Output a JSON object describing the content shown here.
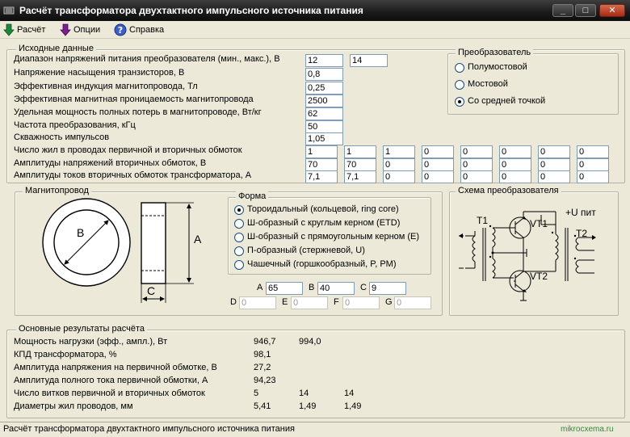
{
  "window": {
    "title": "Расчёт трансформатора двухтактного импульсного источника питания",
    "btn_min": "_",
    "btn_max": "□",
    "btn_close": "✕"
  },
  "toolbar": {
    "calc": "Расчёт",
    "options": "Опции",
    "help": "Справка"
  },
  "input": {
    "title": "Исходные данные",
    "rows": [
      {
        "label": "Диапазон напряжений питания преобразователя (мин., макс.), В",
        "v1": "12",
        "v2": "14"
      },
      {
        "label": "Напряжение насыщения транзисторов, В",
        "v1": "0,8"
      },
      {
        "label": "Эффективная индукция магнитопровода, Тл",
        "v1": "0,25"
      },
      {
        "label": "Эффективная магнитная проницаемость магнитопровода",
        "v1": "2500"
      },
      {
        "label": "Удельная мощность полных потерь в магнитопроводе, Вт/кг",
        "v1": "62"
      },
      {
        "label": "Частота преобразования, кГц",
        "v1": "50"
      },
      {
        "label": "Скважность импульсов",
        "v1": "1,05"
      }
    ],
    "strands_label": "Число жил в проводах первичной и вторичных обмоток",
    "strands": [
      "1",
      "1",
      "1",
      "0",
      "0",
      "0",
      "0",
      "0"
    ],
    "volt_label": "Амплитуды напряжений вторичных обмоток, В",
    "volts": [
      "70",
      "70",
      "0",
      "0",
      "0",
      "0",
      "0",
      "0"
    ],
    "curr_label": "Амплитуды токов вторичных обмоток трансформатора, А",
    "currs": [
      "7,1",
      "7,1",
      "0",
      "0",
      "0",
      "0",
      "0",
      "0"
    ]
  },
  "converter": {
    "title": "Преобразователь",
    "options": [
      "Полумостовой",
      "Мостовой",
      "Со средней точкой"
    ]
  },
  "core": {
    "title": "Магнитопровод",
    "label_b": "B",
    "label_a": "A",
    "label_c": "C"
  },
  "shape": {
    "title": "Форма",
    "options": [
      "Тороидальный (кольцевой, ring core)",
      "Ш-образный с круглым керном (ETD)",
      "Ш-образный с прямоугольным керном (E)",
      "П-образный (стержневой, U)",
      "Чашечный (горшкообразный, P, PM)"
    ]
  },
  "dims": {
    "a_label": "A",
    "a": "65",
    "b_label": "B",
    "b": "40",
    "c_label": "C",
    "c": "9",
    "d_label": "D",
    "d": "0",
    "e_label": "E",
    "e": "0",
    "f_label": "F",
    "f": "0",
    "g_label": "G",
    "g": "0"
  },
  "schema": {
    "title": "Схема преобразователя",
    "t1": "T1",
    "t2": "T2",
    "vt1": "VT1",
    "vt2": "VT2",
    "upit": "+U пит"
  },
  "results": {
    "title": "Основные результаты расчёта",
    "rows": [
      {
        "label": "Мощность нагрузки (эфф., ампл.), Вт",
        "vals": [
          "946,7",
          "994,0"
        ]
      },
      {
        "label": "КПД трансформатора, %",
        "vals": [
          "98,1"
        ]
      },
      {
        "label": "Амплитуда напряжения на первичной обмотке, В",
        "vals": [
          "27,2"
        ]
      },
      {
        "label": "Амплитуда полного тока первичной обмотки, А",
        "vals": [
          "94,23"
        ]
      },
      {
        "label": "Число витков первичной и вторичных обмоток",
        "vals": [
          "5",
          "14",
          "14"
        ]
      },
      {
        "label": "Диаметры жил проводов, мм",
        "vals": [
          "5,41",
          "1,49",
          "1,49"
        ]
      }
    ]
  },
  "status": {
    "text": "Расчёт трансформатора двухтактного импульсного источника питания",
    "watermark": "mikrocxema.ru"
  },
  "colors": {
    "accent_green": "#1a8a3a",
    "accent_purple": "#7a1f8f",
    "help_blue": "#3a5fcd"
  }
}
